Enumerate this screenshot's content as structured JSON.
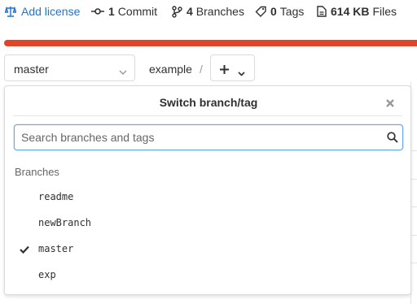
{
  "stats": {
    "license": {
      "label": "Add license",
      "icon": "scale-icon"
    },
    "commits": {
      "count": "1",
      "label": "Commit",
      "icon": "commit-icon"
    },
    "branches": {
      "count": "4",
      "label": "Branches",
      "icon": "branch-icon"
    },
    "tags": {
      "count": "0",
      "label": "Tags",
      "icon": "tag-icon"
    },
    "files": {
      "count": "614 KB",
      "label": "Files",
      "icon": "file-icon"
    }
  },
  "progress_color": "#e24329",
  "toolbar": {
    "selected_branch": "master",
    "path_root": "example",
    "path_separator": "/",
    "add_icon": "plus-icon"
  },
  "dropdown": {
    "title": "Switch branch/tag",
    "search_placeholder": "Search branches and tags",
    "section_header": "Branches",
    "items": [
      {
        "label": "readme",
        "selected": false
      },
      {
        "label": "newBranch",
        "selected": false
      },
      {
        "label": "master",
        "selected": true
      },
      {
        "label": "exp",
        "selected": false
      }
    ]
  }
}
